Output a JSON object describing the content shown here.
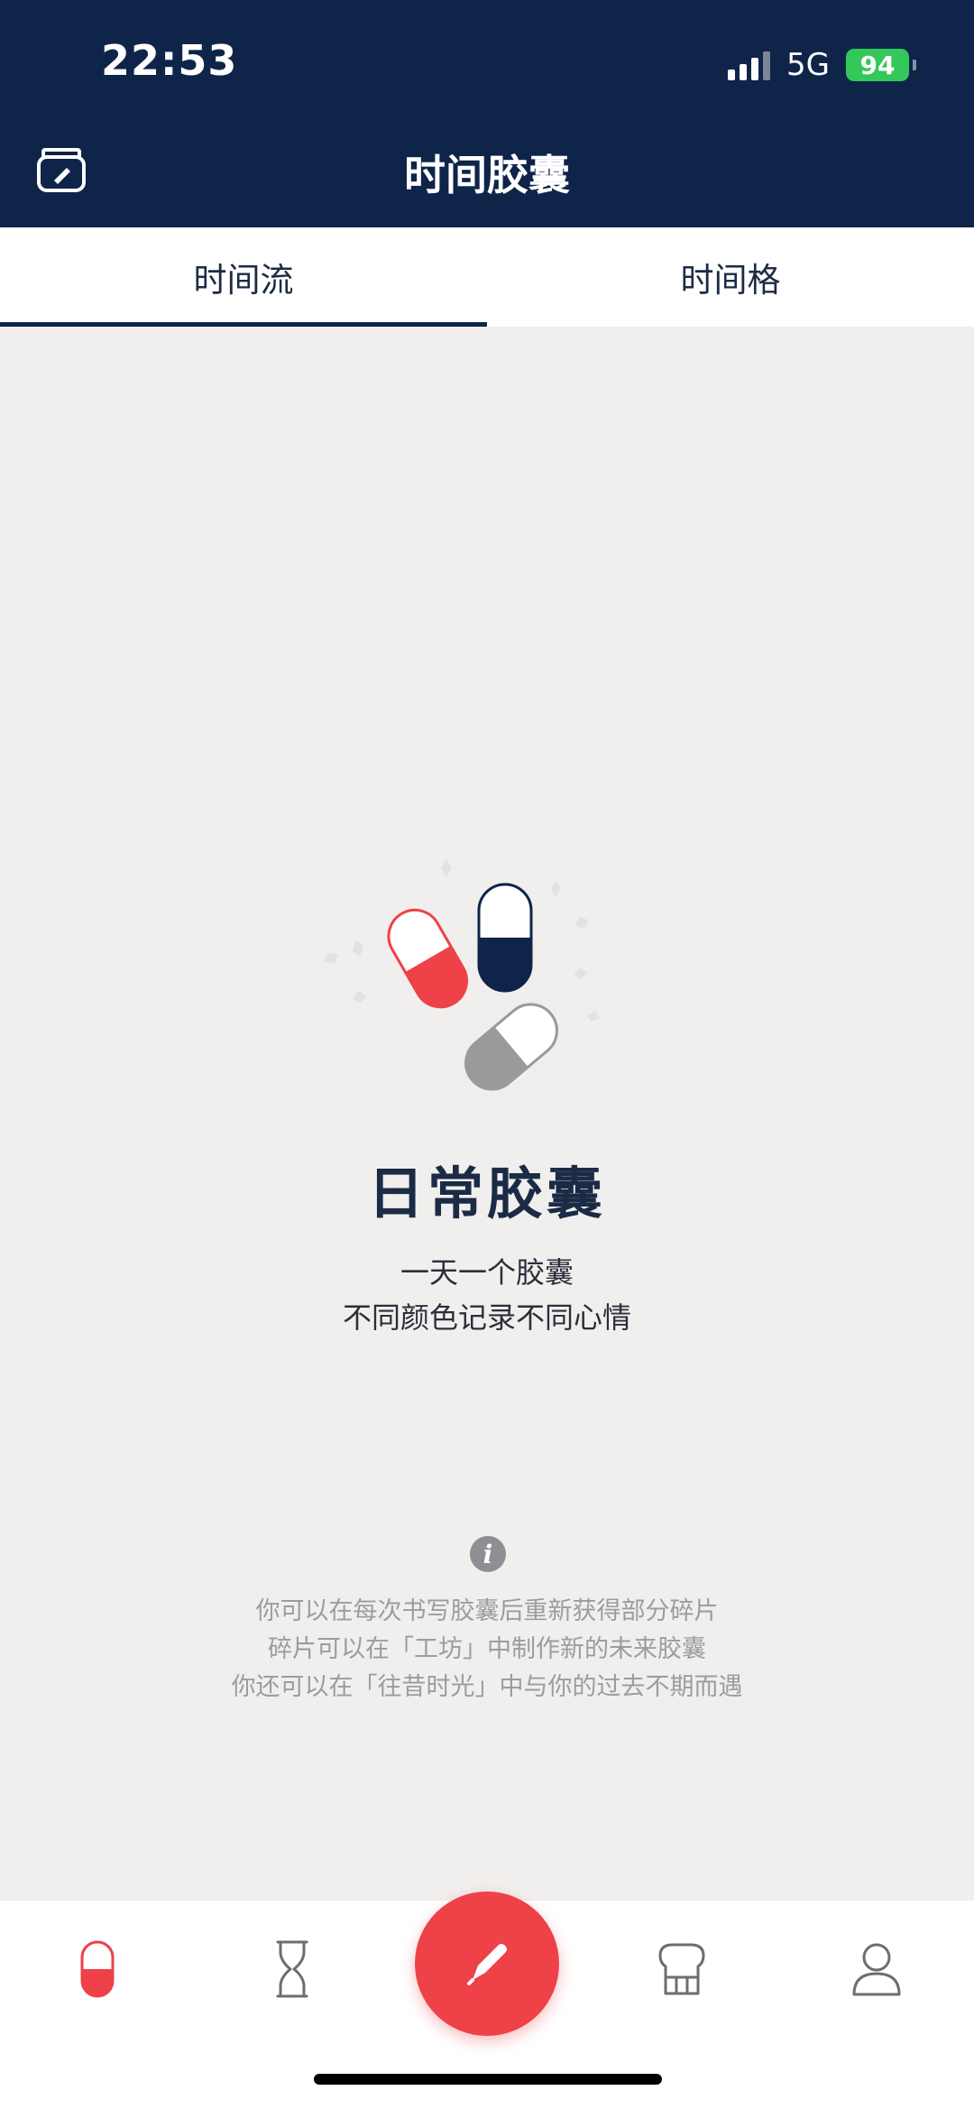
{
  "status_bar": {
    "time": "22:53",
    "network": "5G",
    "battery": "94"
  },
  "header": {
    "title": "时间胶囊",
    "left_icon": "jar-icon"
  },
  "tabs": [
    {
      "label": "时间流",
      "active": true
    },
    {
      "label": "时间格",
      "active": false
    }
  ],
  "empty_state": {
    "title": "日常胶囊",
    "desc_line1": "一天一个胶囊",
    "desc_line2": "不同颜色记录不同心情",
    "capsule_colors": [
      "#ee4148",
      "#0f2449",
      "#9a9a9a"
    ]
  },
  "tips": {
    "icon": "info-icon",
    "line1": "你可以在每次书写胶囊后重新获得部分碎片",
    "line2": "碎片可以在「工坊」中制作新的未来胶囊",
    "line3": "你还可以在「往昔时光」中与你的过去不期而遇"
  },
  "tabbar": {
    "items": [
      {
        "icon": "capsule-icon",
        "active": true
      },
      {
        "icon": "hourglass-icon",
        "active": false
      },
      {
        "icon": "pencil-icon",
        "active": false
      },
      {
        "icon": "workshop-icon",
        "active": false
      },
      {
        "icon": "user-icon",
        "active": false
      }
    ],
    "accent_color": "#ee4148"
  },
  "colors": {
    "header_bg": "#0f2449",
    "page_bg": "#f0efed",
    "accent": "#ee4148"
  }
}
